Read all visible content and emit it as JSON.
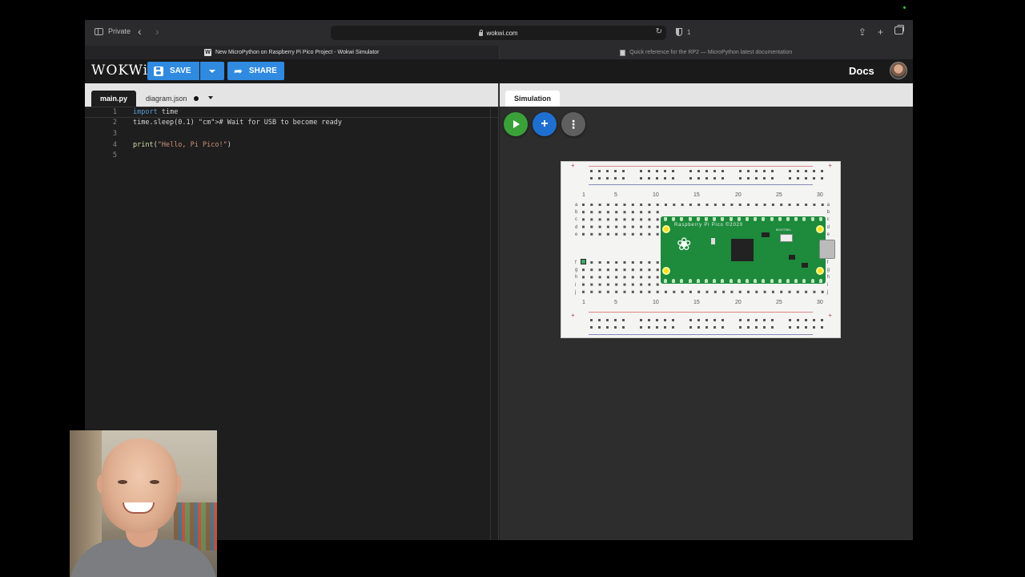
{
  "browser": {
    "private_label": "Private",
    "url": "wokwi.com",
    "shield_count": "1",
    "tabs": [
      {
        "title": "New MicroPython on Raspberry Pi Pico Project - Wokwi Simulator",
        "active": true
      },
      {
        "title": "Quick reference for the RP2 — MicroPython latest documentation",
        "active": false
      }
    ]
  },
  "header": {
    "logo": "WOKWi",
    "save_label": "SAVE",
    "share_label": "SHARE",
    "docs_label": "Docs"
  },
  "editor": {
    "tabs": [
      {
        "label": "main.py",
        "active": true
      },
      {
        "label": "diagram.json",
        "modified": true
      }
    ],
    "lines": [
      {
        "num": "1",
        "code": "import time"
      },
      {
        "num": "2",
        "code": "time.sleep(0.1) # Wait for USB to become ready"
      },
      {
        "num": "3",
        "code": ""
      },
      {
        "num": "4",
        "code": "print(\"Hello, Pi Pico!\")"
      },
      {
        "num": "5",
        "code": ""
      }
    ]
  },
  "simulation": {
    "tab_label": "Simulation",
    "board_label": "Raspberry Pi Pico ©2020",
    "bootsel_label": "BOOTSEL",
    "column_numbers": [
      "1",
      "5",
      "10",
      "15",
      "20",
      "25",
      "30"
    ],
    "row_letters_top": [
      "a",
      "b",
      "c",
      "d",
      "e"
    ],
    "row_letters_bottom": [
      "f",
      "g",
      "h",
      "i",
      "j"
    ]
  },
  "colors": {
    "accent_blue": "#2f8ae0",
    "run_green": "#3aa13a",
    "add_blue": "#1e6fd0",
    "board_green": "#1d8a3c"
  }
}
